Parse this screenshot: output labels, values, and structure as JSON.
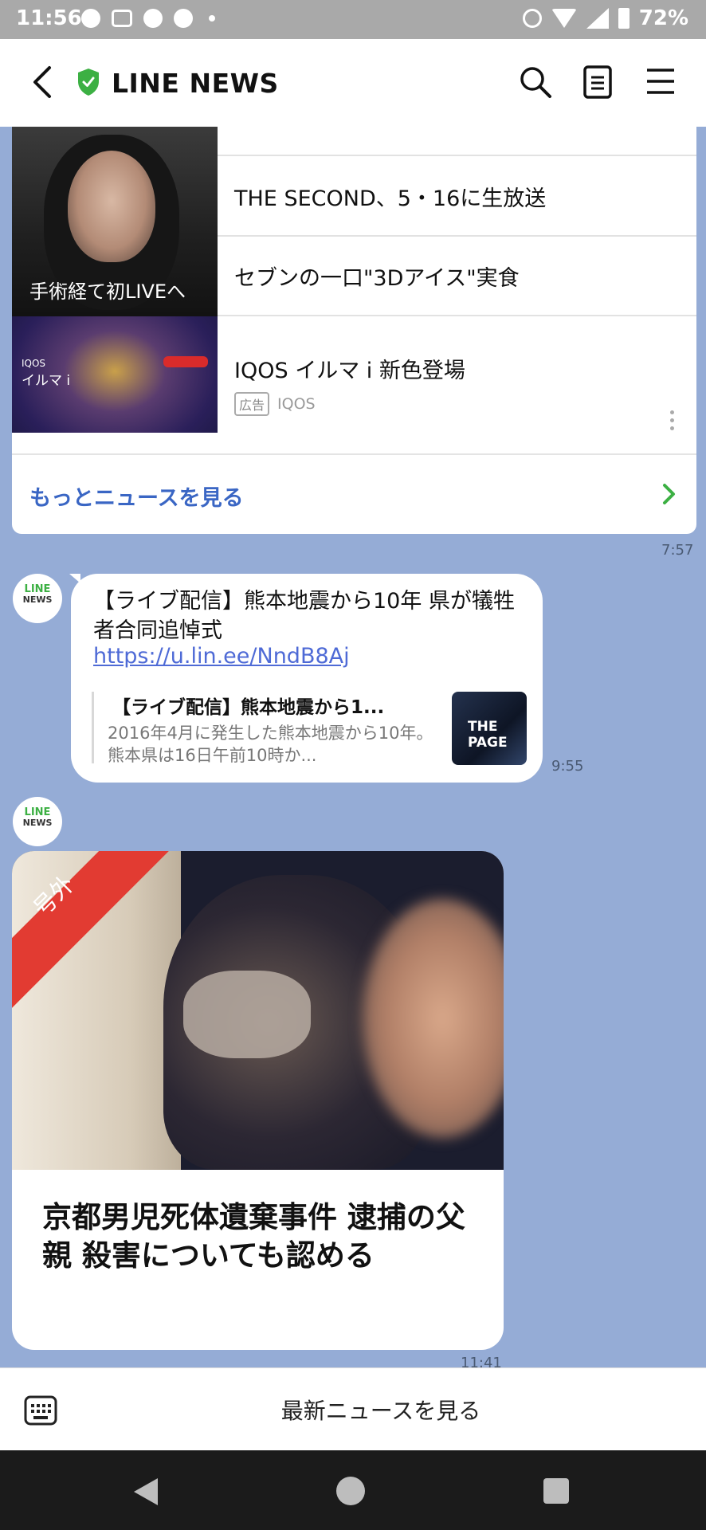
{
  "status_bar": {
    "time": "11:56",
    "battery": "72%"
  },
  "app": {
    "title": "LINE NEWS",
    "accent": "#3cb043"
  },
  "news_card": {
    "photo_caption": "手術経て初LIVEへ",
    "headlines": [
      "THE SECOND、5・16に生放送",
      "セブンの一口\"3Dアイス\"実食",
      "IQOS イルマ i 新色登場"
    ],
    "ad_badge": "広告",
    "ad_sponsor": "IQOS",
    "ad_image_text": {
      "brand": "IQOS",
      "product": "イルマ i"
    },
    "more_label": "もっとニュースを見る"
  },
  "timestamps": {
    "card": "7:57",
    "message": "9:55",
    "breaking": "11:41"
  },
  "avatar": {
    "line1": "LINE",
    "line2": "NEWS"
  },
  "message": {
    "text": "【ライブ配信】熊本地震から10年 県が犠牲者合同追悼式",
    "link": "https://u.lin.ee/NndB8Aj",
    "preview_title": "【ライブ配信】熊本地震から1...",
    "preview_desc": "2016年4月に発生した熊本地震から10年。熊本県は16日午前10時か...",
    "preview_thumb_text": "THE PAGE"
  },
  "breaking": {
    "ribbon": "号外",
    "title": "京都男児死体遺棄事件 逮捕の父親 殺害についても認める",
    "ribbon_color": "#e23b32"
  },
  "bottom_bar": {
    "latest_label": "最新ニュースを見る"
  }
}
